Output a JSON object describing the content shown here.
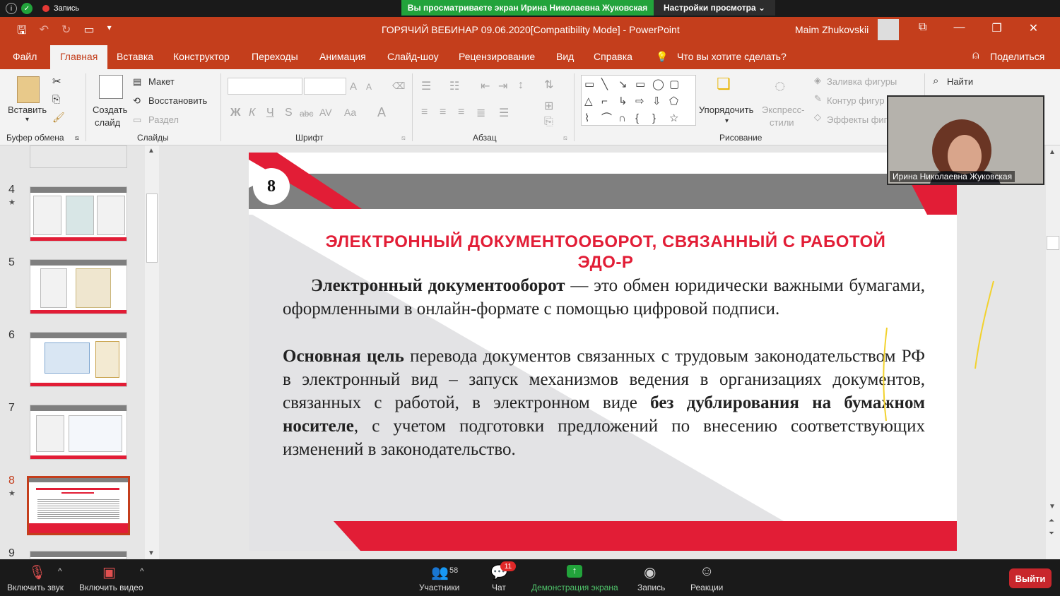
{
  "zoom_top": {
    "record_label": "Запись",
    "banner": "Вы просматриваете экран Ирина Николаевна Жуковская",
    "view_options": "Настройки просмотра ⌄"
  },
  "window": {
    "title": "ГОРЯЧИЙ ВЕБИНАР 09.06.2020[Compatibility Mode]  -  PowerPoint",
    "user": "Maim Zhukovskii"
  },
  "tabs": [
    "Файл",
    "Главная",
    "Вставка",
    "Конструктор",
    "Переходы",
    "Анимация",
    "Слайд-шоу",
    "Рецензирование",
    "Вид",
    "Справка"
  ],
  "tell_me": "Что вы хотите сделать?",
  "share": "Поделиться",
  "ribbon": {
    "paste": "Вставить",
    "clipboard_group": "Буфер обмена",
    "new_slide_1": "Создать",
    "new_slide_2": "слайд",
    "layout": "Макет",
    "reset": "Восстановить",
    "section": "Раздел",
    "slides_group": "Слайды",
    "font_group": "Шрифт",
    "paragraph_group": "Абзац",
    "arrange": "Упорядочить",
    "quick_styles_1": "Экспресс-",
    "quick_styles_2": "стили",
    "fill": "Заливка фигуры",
    "outline": "Контур фигур",
    "effects": "Эффекты фиг",
    "drawing_group": "Рисование",
    "find": "Найти",
    "font_format": [
      "Ж",
      "К",
      "Ч",
      "S",
      "abc",
      "AV",
      "Aa",
      "A"
    ]
  },
  "thumbnails": [
    {
      "num": "4"
    },
    {
      "num": "5"
    },
    {
      "num": "6"
    },
    {
      "num": "7"
    },
    {
      "num": "8"
    },
    {
      "num": "9"
    }
  ],
  "slide": {
    "number": "8",
    "title_line1": "ЭЛЕКТРОННЫЙ ДОКУМЕНТООБОРОТ, СВЯЗАННЫЙ С РАБОТОЙ",
    "title_line2": "ЭДО-Р",
    "p1_bold": "Электронный документооборот",
    "p1_rest": " — это обмен юридически важными бумагами, оформленными в онлайн-формате с помощью цифровой подписи.",
    "p2_bold1": "Основная цель",
    "p2_mid": " перевода документов связанных с трудовым законодательством РФ в электронный вид – запуск механизмов ведения в организациях документов, связанных с работой, в электронном виде ",
    "p2_bold2": "без дублирования на бумажном носителе",
    "p2_end": ", с учетом подготовки предложений по внесению соответствующих изменений в законодательство."
  },
  "video": {
    "name": "Ирина Николаевна Жуковская"
  },
  "zoom_bottom": {
    "mute": "Включить звук",
    "video": "Включить видео",
    "participants": "Участники",
    "participants_count": "58",
    "chat": "Чат",
    "chat_badge": "11",
    "share": "Демонстрация экрана",
    "record": "Запись",
    "reactions": "Реакции",
    "exit": "Выйти"
  },
  "colors": {
    "accent": "#c43e1c",
    "slide_red": "#e21d36",
    "zoom_green": "#22a33b"
  }
}
